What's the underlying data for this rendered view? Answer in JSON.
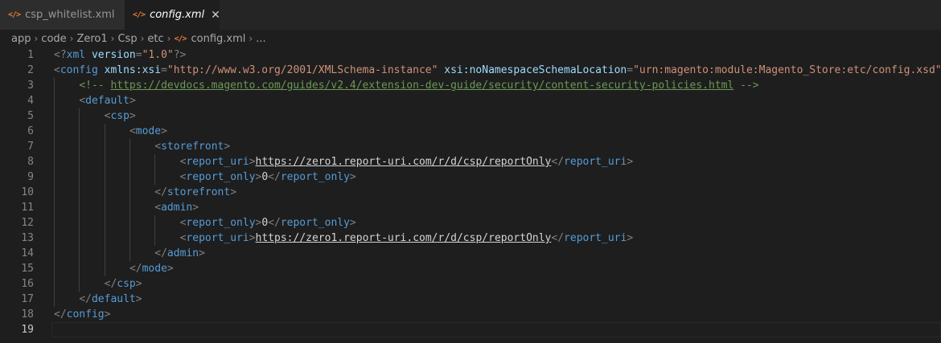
{
  "tabs": [
    {
      "label": "csp_whitelist.xml",
      "icon": "xml-file-icon",
      "active": false
    },
    {
      "label": "config.xml",
      "icon": "xml-file-icon",
      "active": true,
      "close_glyph": "✕"
    }
  ],
  "breadcrumb": {
    "segments": [
      "app",
      "code",
      "Zero1",
      "Csp",
      "etc"
    ],
    "file": "config.xml",
    "trailing": "..."
  },
  "icon_glyph": "</>",
  "separator_glyph": "›",
  "colors": {
    "background": "#1e1e1e",
    "tabbar": "#252526",
    "tag": "#569cd6",
    "attribute": "#9cdcfe",
    "string": "#ce9178",
    "comment": "#6a9955",
    "punctuation": "#808080",
    "line_number": "#858585",
    "xml_icon": "#e37933"
  },
  "editor": {
    "current_line": 19,
    "lines": [
      {
        "n": "1",
        "indent": 0,
        "tokens": [
          [
            "pi",
            "<?"
          ],
          [
            "tag",
            "xml"
          ],
          [
            "text",
            " "
          ],
          [
            "attr",
            "version"
          ],
          [
            "punct",
            "="
          ],
          [
            "val",
            "\"1.0\""
          ],
          [
            "pi",
            "?>"
          ]
        ]
      },
      {
        "n": "2",
        "indent": 0,
        "tokens": [
          [
            "punct",
            "<"
          ],
          [
            "tag",
            "config"
          ],
          [
            "text",
            " "
          ],
          [
            "attr",
            "xmlns:xsi"
          ],
          [
            "punct",
            "="
          ],
          [
            "val",
            "\"http://www.w3.org/2001/XMLSchema-instance\""
          ],
          [
            "text",
            " "
          ],
          [
            "attr",
            "xsi:noNamespaceSchemaLocation"
          ],
          [
            "punct",
            "="
          ],
          [
            "val",
            "\"urn:magento:module:Magento_Store:etc/config.xsd\""
          ],
          [
            "punct",
            ">"
          ]
        ]
      },
      {
        "n": "3",
        "indent": 1,
        "tokens": [
          [
            "comment",
            "<!-- "
          ],
          [
            "comment-link",
            "https://devdocs.magento.com/guides/v2.4/extension-dev-guide/security/content-security-policies.html"
          ],
          [
            "comment",
            " -->"
          ]
        ]
      },
      {
        "n": "4",
        "indent": 1,
        "tokens": [
          [
            "punct",
            "<"
          ],
          [
            "tag",
            "default"
          ],
          [
            "punct",
            ">"
          ]
        ]
      },
      {
        "n": "5",
        "indent": 2,
        "tokens": [
          [
            "punct",
            "<"
          ],
          [
            "tag",
            "csp"
          ],
          [
            "punct",
            ">"
          ]
        ]
      },
      {
        "n": "6",
        "indent": 3,
        "tokens": [
          [
            "punct",
            "<"
          ],
          [
            "tag",
            "mode"
          ],
          [
            "punct",
            ">"
          ]
        ]
      },
      {
        "n": "7",
        "indent": 4,
        "tokens": [
          [
            "punct",
            "<"
          ],
          [
            "tag",
            "storefront"
          ],
          [
            "punct",
            ">"
          ]
        ]
      },
      {
        "n": "8",
        "indent": 5,
        "tokens": [
          [
            "punct",
            "<"
          ],
          [
            "tag",
            "report_uri"
          ],
          [
            "punct",
            ">"
          ],
          [
            "link",
            "https://zero1.report-uri.com/r/d/csp/reportOnly"
          ],
          [
            "punct",
            "</"
          ],
          [
            "tag",
            "report_uri"
          ],
          [
            "punct",
            ">"
          ]
        ]
      },
      {
        "n": "9",
        "indent": 5,
        "tokens": [
          [
            "punct",
            "<"
          ],
          [
            "tag",
            "report_only"
          ],
          [
            "punct",
            ">"
          ],
          [
            "text",
            "0"
          ],
          [
            "punct",
            "</"
          ],
          [
            "tag",
            "report_only"
          ],
          [
            "punct",
            ">"
          ]
        ]
      },
      {
        "n": "10",
        "indent": 4,
        "tokens": [
          [
            "punct",
            "</"
          ],
          [
            "tag",
            "storefront"
          ],
          [
            "punct",
            ">"
          ]
        ]
      },
      {
        "n": "11",
        "indent": 4,
        "tokens": [
          [
            "punct",
            "<"
          ],
          [
            "tag",
            "admin"
          ],
          [
            "punct",
            ">"
          ]
        ]
      },
      {
        "n": "12",
        "indent": 5,
        "tokens": [
          [
            "punct",
            "<"
          ],
          [
            "tag",
            "report_only"
          ],
          [
            "punct",
            ">"
          ],
          [
            "text",
            "0"
          ],
          [
            "punct",
            "</"
          ],
          [
            "tag",
            "report_only"
          ],
          [
            "punct",
            ">"
          ]
        ]
      },
      {
        "n": "13",
        "indent": 5,
        "tokens": [
          [
            "punct",
            "<"
          ],
          [
            "tag",
            "report_uri"
          ],
          [
            "punct",
            ">"
          ],
          [
            "link",
            "https://zero1.report-uri.com/r/d/csp/reportOnly"
          ],
          [
            "punct",
            "</"
          ],
          [
            "tag",
            "report_uri"
          ],
          [
            "punct",
            ">"
          ]
        ]
      },
      {
        "n": "14",
        "indent": 4,
        "tokens": [
          [
            "punct",
            "</"
          ],
          [
            "tag",
            "admin"
          ],
          [
            "punct",
            ">"
          ]
        ]
      },
      {
        "n": "15",
        "indent": 3,
        "tokens": [
          [
            "punct",
            "</"
          ],
          [
            "tag",
            "mode"
          ],
          [
            "punct",
            ">"
          ]
        ]
      },
      {
        "n": "16",
        "indent": 2,
        "tokens": [
          [
            "punct",
            "</"
          ],
          [
            "tag",
            "csp"
          ],
          [
            "punct",
            ">"
          ]
        ]
      },
      {
        "n": "17",
        "indent": 1,
        "tokens": [
          [
            "punct",
            "</"
          ],
          [
            "tag",
            "default"
          ],
          [
            "punct",
            ">"
          ]
        ]
      },
      {
        "n": "18",
        "indent": 0,
        "tokens": [
          [
            "punct",
            "</"
          ],
          [
            "tag",
            "config"
          ],
          [
            "punct",
            ">"
          ]
        ]
      },
      {
        "n": "19",
        "indent": 0,
        "tokens": []
      }
    ]
  }
}
